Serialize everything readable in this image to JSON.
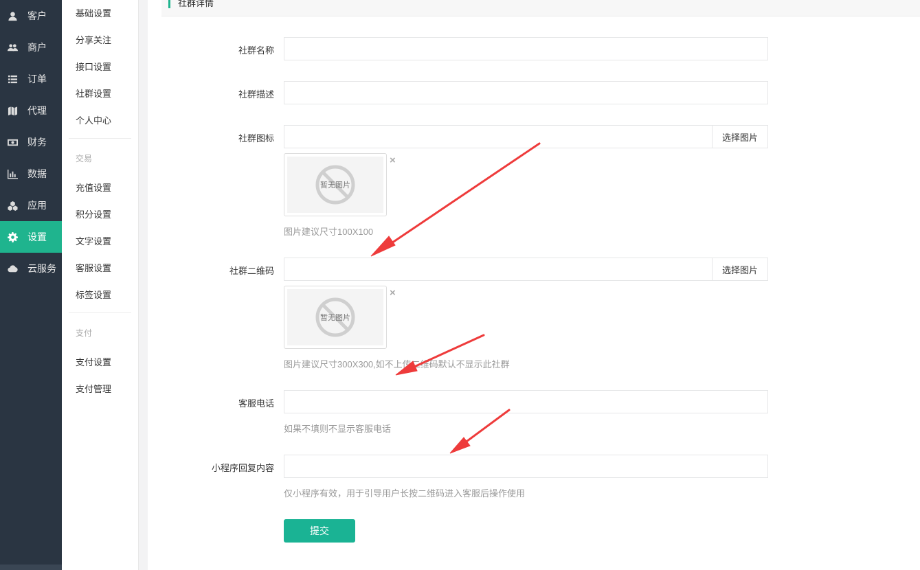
{
  "nav": {
    "items": [
      {
        "label": "客户",
        "icon": "user-icon"
      },
      {
        "label": "商户",
        "icon": "users-icon"
      },
      {
        "label": "订单",
        "icon": "list-icon"
      },
      {
        "label": "代理",
        "icon": "map-icon"
      },
      {
        "label": "财务",
        "icon": "money-icon"
      },
      {
        "label": "数据",
        "icon": "bar-chart-icon"
      },
      {
        "label": "应用",
        "icon": "cubes-icon"
      },
      {
        "label": "设置",
        "icon": "gear-icon",
        "active": true
      },
      {
        "label": "云服务",
        "icon": "cloud-icon"
      }
    ]
  },
  "submenu": {
    "basic": [
      "基础设置",
      "分享关注",
      "接口设置",
      "社群设置",
      "个人中心"
    ],
    "trade_title": "交易",
    "trade": [
      "充值设置",
      "积分设置",
      "文字设置",
      "客服设置",
      "标签设置"
    ],
    "pay_title": "支付",
    "pay": [
      "支付设置",
      "支付管理"
    ]
  },
  "panel": {
    "title": "社群详情"
  },
  "form": {
    "name": {
      "label": "社群名称",
      "value": ""
    },
    "desc": {
      "label": "社群描述",
      "value": ""
    },
    "icon": {
      "label": "社群图标",
      "value": "",
      "button": "选择图片",
      "placeholder_text": "暂无图片",
      "help": "图片建议尺寸100X100"
    },
    "qrcode": {
      "label": "社群二维码",
      "value": "",
      "button": "选择图片",
      "placeholder_text": "暂无图片",
      "help": "图片建议尺寸300X300,如不上传二维码默认不显示此社群"
    },
    "phone": {
      "label": "客服电话",
      "value": "",
      "help": "如果不填则不显示客服电话"
    },
    "reply": {
      "label": "小程序回复内容",
      "value": "",
      "help": "仅小程序有效，用于引导用户长按二维码进入客服后操作使用"
    },
    "close_glyph": "×",
    "submit": "提交"
  },
  "colors": {
    "nav_bg": "#2a3542",
    "accent": "#1ab394",
    "annotation_arrow": "#ee3b3b"
  }
}
